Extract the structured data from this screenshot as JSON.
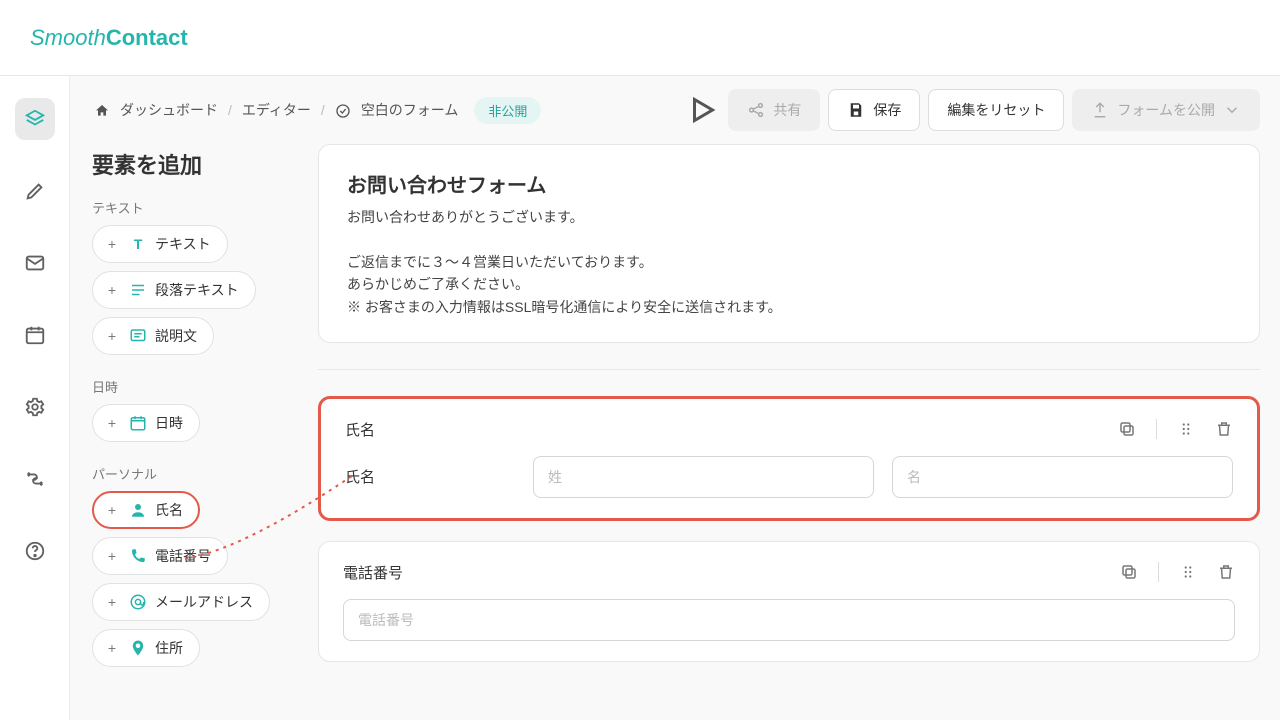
{
  "brand": {
    "smooth": "Smooth",
    "contact": "Contact"
  },
  "toolbar": {
    "dashboard": "ダッシュボード",
    "editor": "エディター",
    "formname": "空白のフォーム",
    "status": "非公開",
    "share": "共有",
    "save": "保存",
    "reset": "編集をリセット",
    "publish": "フォームを公開"
  },
  "panel": {
    "title": "要素を追加",
    "group_text": "テキスト",
    "chip_text": "テキスト",
    "chip_paragraph": "段落テキスト",
    "chip_description": "説明文",
    "group_datetime": "日時",
    "chip_datetime": "日時",
    "group_personal": "パーソナル",
    "chip_name": "氏名",
    "chip_phone": "電話番号",
    "chip_email": "メールアドレス",
    "chip_address": "住所"
  },
  "form": {
    "header_title": "お問い合わせフォーム",
    "header_body": "お問い合わせありがとうございます。\n\nご返信までに３〜４営業日いただいております。\nあらかじめご了承ください。\n※ お客さまの入力情報はSSL暗号化通信により安全に送信されます。",
    "name_field_title": "氏名",
    "name_label": "氏名",
    "name_placeholder_last": "姓",
    "name_placeholder_first": "名",
    "phone_field_title": "電話番号",
    "phone_placeholder": "電話番号"
  }
}
